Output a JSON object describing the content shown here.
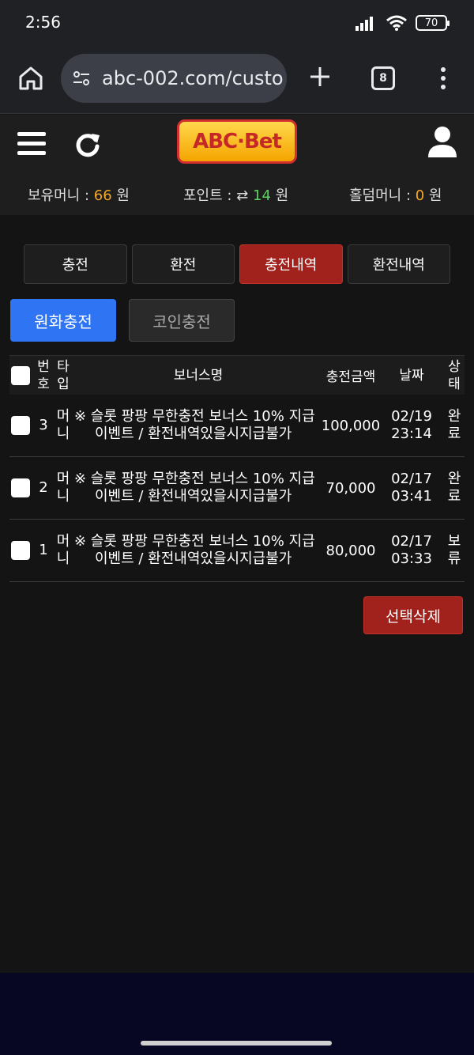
{
  "status_bar": {
    "time": "2:56",
    "battery": "70"
  },
  "browser": {
    "url": "abc-002.com/custo",
    "tab_count": "8"
  },
  "header": {
    "logo_text": "ABC·Bet",
    "balance_label": "보유머니 : ",
    "balance_value": "66",
    "balance_unit": " 원",
    "point_label": "포인트 : ",
    "point_icon": "⇄",
    "point_value": "14",
    "point_unit": " 원",
    "holdem_label": "홀덤머니 : ",
    "holdem_value": "0",
    "holdem_unit": " 원"
  },
  "tabs": [
    {
      "label": "충전"
    },
    {
      "label": "환전"
    },
    {
      "label": "충전내역"
    },
    {
      "label": "환전내역"
    }
  ],
  "subtabs": [
    {
      "label": "원화충전"
    },
    {
      "label": "코인충전"
    }
  ],
  "table": {
    "headers": {
      "no_line1": "번",
      "no_line2": "호",
      "type_line1": "타",
      "type_line2": "입",
      "name": "보너스명",
      "amount": "충전금액",
      "date": "날짜",
      "status_line1": "상",
      "status_line2": "태"
    },
    "rows": [
      {
        "no": "3",
        "type_line1": "머",
        "type_line2": "니",
        "name_line1": "※ 슬롯 팡팡 무한충전 보너스 10% 지급",
        "name_line2": "이벤트 / 환전내역있을시지급불가",
        "amount": "100,000",
        "date": "02/19",
        "time": "23:14",
        "status_line1": "완",
        "status_line2": "료"
      },
      {
        "no": "2",
        "type_line1": "머",
        "type_line2": "니",
        "name_line1": "※ 슬롯 팡팡 무한충전 보너스 10% 지급",
        "name_line2": "이벤트 / 환전내역있을시지급불가",
        "amount": "70,000",
        "date": "02/17",
        "time": "03:41",
        "status_line1": "완",
        "status_line2": "료"
      },
      {
        "no": "1",
        "type_line1": "머",
        "type_line2": "니",
        "name_line1": "※ 슬롯 팡팡 무한충전 보너스 10% 지급",
        "name_line2": "이벤트 / 환전내역있을시지급불가",
        "amount": "80,000",
        "date": "02/17",
        "time": "03:33",
        "status_line1": "보",
        "status_line2": "류"
      }
    ]
  },
  "delete_button": "선택삭제"
}
